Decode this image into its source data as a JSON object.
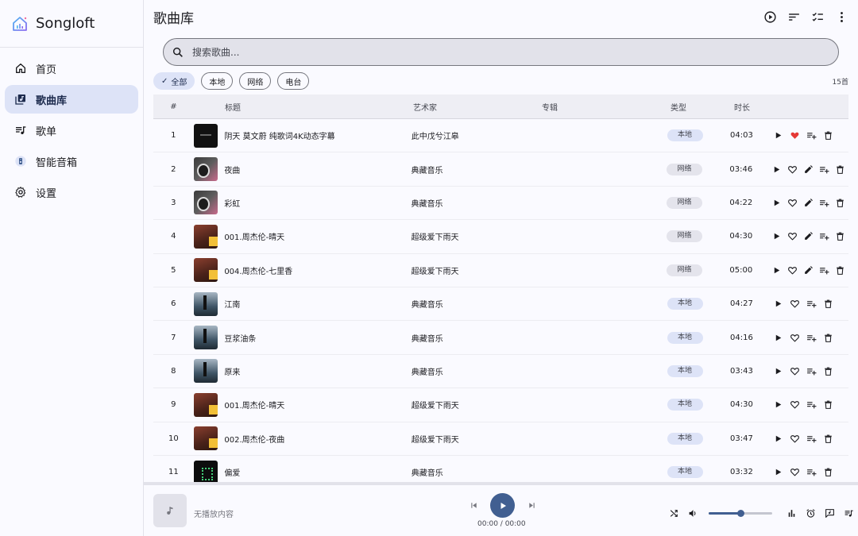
{
  "app": {
    "name": "Songloft"
  },
  "sidebar": {
    "items": [
      {
        "label": "首页",
        "icon": "home-icon",
        "active": false
      },
      {
        "label": "歌曲库",
        "icon": "library-music-icon",
        "active": true
      },
      {
        "label": "歌单",
        "icon": "playlist-icon",
        "active": false
      },
      {
        "label": "智能音箱",
        "icon": "speaker-icon",
        "active": false
      },
      {
        "label": "设置",
        "icon": "settings-icon",
        "active": false
      }
    ]
  },
  "header": {
    "title": "歌曲库"
  },
  "search": {
    "placeholder": "搜索歌曲..."
  },
  "filters": {
    "chips": [
      "全部",
      "本地",
      "网络",
      "电台"
    ],
    "selected": "全部",
    "count": "15首"
  },
  "table": {
    "columns": {
      "num": "#",
      "title": "标题",
      "artist": "艺术家",
      "album": "专辑",
      "type": "类型",
      "duration": "时长"
    },
    "rows": [
      {
        "num": "1",
        "title": "阴天 莫文蔚 纯歌词4K动态字幕",
        "artist": "此中戊兮江皋",
        "album": "",
        "type": "本地",
        "duration": "04:03",
        "cover": "dark",
        "liked": true,
        "editable": false
      },
      {
        "num": "2",
        "title": "夜曲",
        "artist": "典藏音乐",
        "album": "",
        "type": "网络",
        "duration": "03:46",
        "cover": "pink",
        "liked": false,
        "editable": true
      },
      {
        "num": "3",
        "title": "彩虹",
        "artist": "典藏音乐",
        "album": "",
        "type": "网络",
        "duration": "04:22",
        "cover": "pink",
        "liked": false,
        "editable": true
      },
      {
        "num": "4",
        "title": "001.周杰伦-晴天",
        "artist": "超级爱下雨天",
        "album": "",
        "type": "网络",
        "duration": "04:30",
        "cover": "jay",
        "liked": false,
        "editable": true
      },
      {
        "num": "5",
        "title": "004.周杰伦-七里香",
        "artist": "超级爱下雨天",
        "album": "",
        "type": "网络",
        "duration": "05:00",
        "cover": "jay",
        "liked": false,
        "editable": true
      },
      {
        "num": "6",
        "title": "江南",
        "artist": "典藏音乐",
        "album": "",
        "type": "本地",
        "duration": "04:27",
        "cover": "blue",
        "liked": false,
        "editable": false
      },
      {
        "num": "7",
        "title": "豆浆油条",
        "artist": "典藏音乐",
        "album": "",
        "type": "本地",
        "duration": "04:16",
        "cover": "blue",
        "liked": false,
        "editable": false
      },
      {
        "num": "8",
        "title": "原来",
        "artist": "典藏音乐",
        "album": "",
        "type": "本地",
        "duration": "03:43",
        "cover": "blue",
        "liked": false,
        "editable": false
      },
      {
        "num": "9",
        "title": "001.周杰伦-晴天",
        "artist": "超级爱下雨天",
        "album": "",
        "type": "本地",
        "duration": "04:30",
        "cover": "jay",
        "liked": false,
        "editable": false
      },
      {
        "num": "10",
        "title": "002.周杰伦-夜曲",
        "artist": "超级爱下雨天",
        "album": "",
        "type": "本地",
        "duration": "03:47",
        "cover": "jay",
        "liked": false,
        "editable": false
      },
      {
        "num": "11",
        "title": "偏爱",
        "artist": "典藏音乐",
        "album": "",
        "type": "本地",
        "duration": "03:32",
        "cover": "green",
        "liked": false,
        "editable": false
      }
    ]
  },
  "player": {
    "now_playing": "无播放内容",
    "time": "00:00 / 00:00",
    "volume": 0.5
  },
  "colors": {
    "accent": "#415f91",
    "liked": "#e53935",
    "chip_active": "#dde3f7"
  }
}
